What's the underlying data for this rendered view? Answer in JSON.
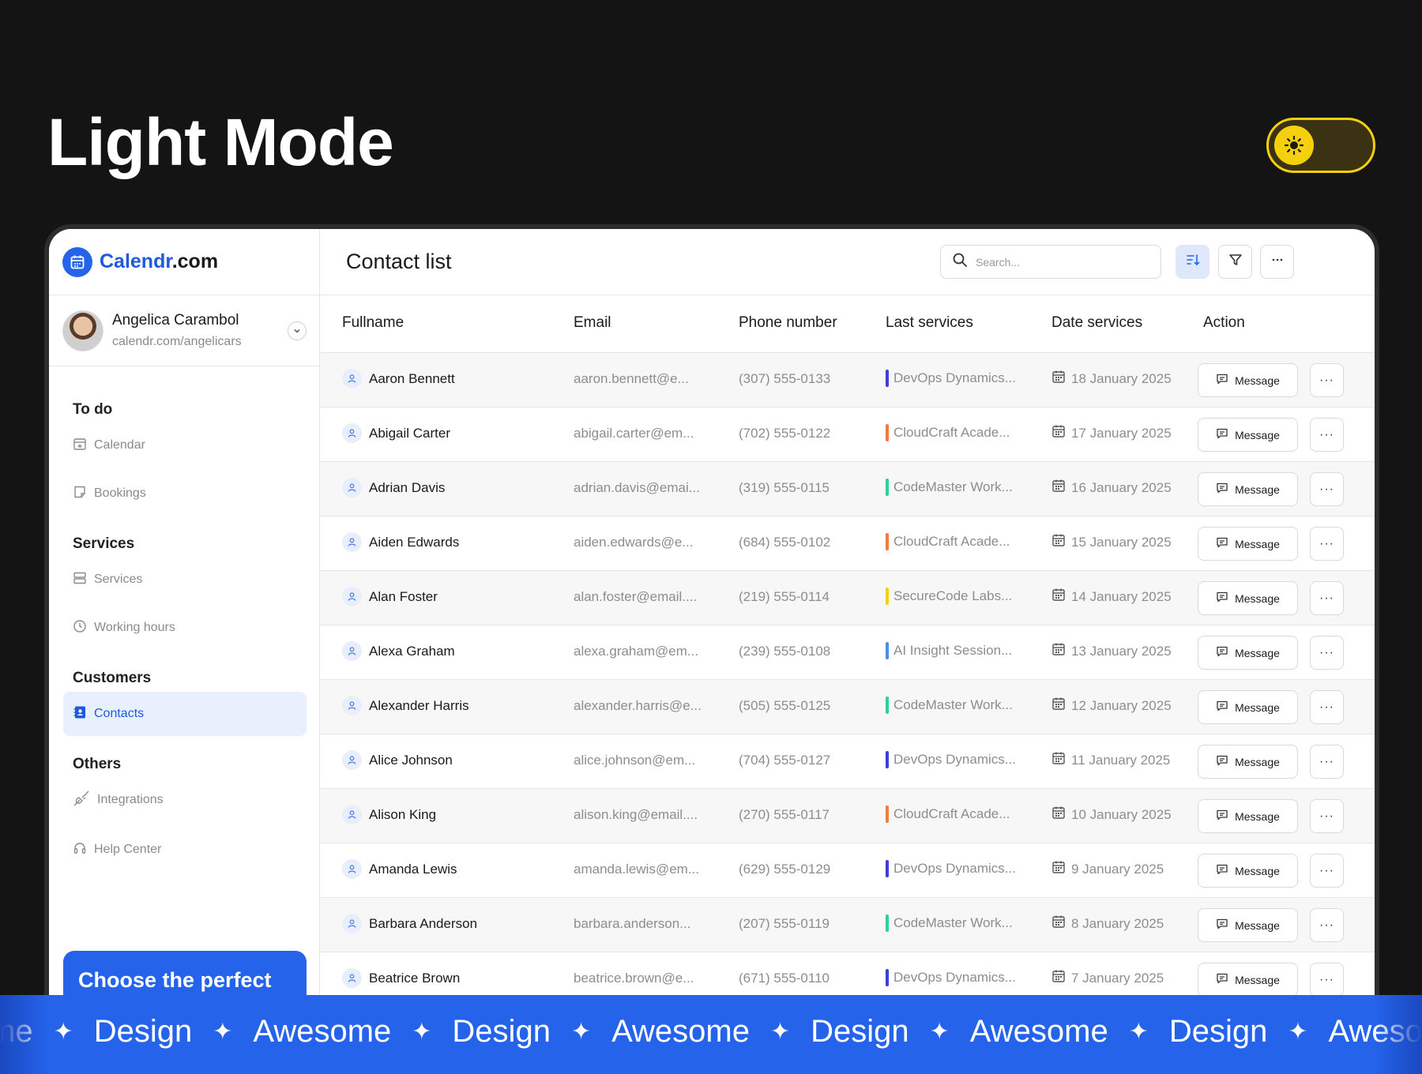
{
  "hero": {
    "title": "Light Mode"
  },
  "brand": {
    "name_accent": "Calendr",
    "name_rest": ".com"
  },
  "user": {
    "name": "Angelica Carambol",
    "url": "calendr.com/angelicars"
  },
  "nav": {
    "todo_heading": "To do",
    "calendar": "Calendar",
    "bookings": "Bookings",
    "services_heading": "Services",
    "services": "Services",
    "working_hours": "Working hours",
    "customers_heading": "Customers",
    "contacts": "Contacts",
    "others_heading": "Others",
    "integrations": "Integrations",
    "help_center": "Help Center"
  },
  "promo": {
    "text": "Choose the perfect"
  },
  "page": {
    "title": "Contact list"
  },
  "search": {
    "placeholder": "Search..."
  },
  "table": {
    "headers": {
      "fullname": "Fullname",
      "email": "Email",
      "phone": "Phone number",
      "last_services": "Last services",
      "date_services": "Date services",
      "action": "Action"
    },
    "message_label": "Message",
    "more_label": "···",
    "rows": [
      {
        "name": "Aaron Bennett",
        "email": "aaron.bennett@e...",
        "phone": "(307) 555-0133",
        "service": "DevOps Dynamics...",
        "service_color": "#3b3fd8",
        "date": "18 January 2025"
      },
      {
        "name": "Abigail Carter",
        "email": "abigail.carter@em...",
        "phone": "(702) 555-0122",
        "service": "CloudCraft Acade...",
        "service_color": "#f07a45",
        "date": "17 January 2025"
      },
      {
        "name": "Adrian Davis",
        "email": "adrian.davis@emai...",
        "phone": "(319) 555-0115",
        "service": "CodeMaster Work...",
        "service_color": "#2fcf9a",
        "date": "16 January 2025"
      },
      {
        "name": "Aiden Edwards",
        "email": "aiden.edwards@e...",
        "phone": "(684) 555-0102",
        "service": "CloudCraft Acade...",
        "service_color": "#f07a45",
        "date": "15 January 2025"
      },
      {
        "name": "Alan Foster",
        "email": "alan.foster@email....",
        "phone": "(219) 555-0114",
        "service": "SecureCode Labs...",
        "service_color": "#f5d10d",
        "date": "14 January 2025"
      },
      {
        "name": "Alexa Graham",
        "email": "alexa.graham@em...",
        "phone": "(239) 555-0108",
        "service": "AI Insight Session...",
        "service_color": "#4a90e2",
        "date": "13 January 2025"
      },
      {
        "name": "Alexander Harris",
        "email": "alexander.harris@e...",
        "phone": "(505) 555-0125",
        "service": "CodeMaster Work...",
        "service_color": "#2fcf9a",
        "date": "12 January 2025"
      },
      {
        "name": "Alice Johnson",
        "email": "alice.johnson@em...",
        "phone": "(704) 555-0127",
        "service": "DevOps Dynamics...",
        "service_color": "#3b3fd8",
        "date": "11 January 2025"
      },
      {
        "name": "Alison King",
        "email": "alison.king@email....",
        "phone": "(270) 555-0117",
        "service": "CloudCraft Acade...",
        "service_color": "#f07a45",
        "date": "10 January 2025"
      },
      {
        "name": "Amanda Lewis",
        "email": "amanda.lewis@em...",
        "phone": "(629) 555-0129",
        "service": "DevOps Dynamics...",
        "service_color": "#3b3fd8",
        "date": "9 January 2025"
      },
      {
        "name": "Barbara Anderson",
        "email": "barbara.anderson...",
        "phone": "(207) 555-0119",
        "service": "CodeMaster Work...",
        "service_color": "#2fcf9a",
        "date": "8 January 2025"
      },
      {
        "name": "Beatrice Brown",
        "email": "beatrice.brown@e...",
        "phone": "(671) 555-0110",
        "service": "DevOps Dynamics...",
        "service_color": "#3b3fd8",
        "date": "7 January 2025"
      }
    ]
  },
  "marquee": {
    "items": [
      "me",
      "Design",
      "Awesome",
      "Design",
      "Awesome",
      "Design",
      "Awesome",
      "Design",
      "Awesome"
    ],
    "separator": "✦"
  },
  "colors": {
    "accent": "#2563eb",
    "toggle": "#f5d10d",
    "background": "#141414"
  }
}
